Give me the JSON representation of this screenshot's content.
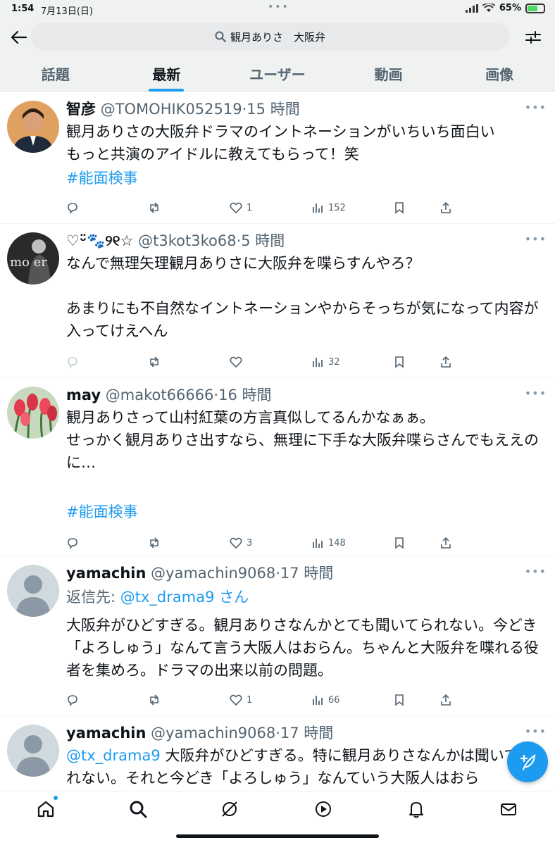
{
  "status_bar": {
    "time": "1:54",
    "date": "7月13日(日)",
    "battery_percent": "65%",
    "battery_level": 0.65
  },
  "search": {
    "query": "観月ありさ　大阪弁"
  },
  "tabs": [
    {
      "label": "話題",
      "active": false
    },
    {
      "label": "最新",
      "active": true
    },
    {
      "label": "ユーザー",
      "active": false
    },
    {
      "label": "動画",
      "active": false
    },
    {
      "label": "画像",
      "active": false
    }
  ],
  "tweets": [
    {
      "name": "智彦",
      "handle": "@TOMOHIK052519",
      "time": "·15 時間",
      "body": "観月ありさの大阪弁ドラマのイントネーションがいちいち面白い\nもっと共演のアイドルに教えてもらって！笑",
      "hashtag": "#能面検事",
      "stats": {
        "replies": "",
        "retweets": "",
        "likes": "1",
        "views": "152"
      }
    },
    {
      "name": "♡ᵕ̈🐾୨୧☆",
      "handle": "@t3kot3ko68",
      "time": "·5 時間",
      "body": "なんで無理矢理観月ありさに大阪弁を喋らすんやろ？\n\nあまりにも不自然なイントネーションやからそっちが気になって内容が入ってけえへん",
      "stats": {
        "replies": "",
        "retweets": "",
        "likes": "",
        "views": "32"
      }
    },
    {
      "name": "may",
      "handle": "@makot66666",
      "time": "·16 時間",
      "body": "観月ありさって山村紅葉の方言真似してるんかなぁぁ。\nせっかく観月ありさ出すなら、無理に下手な大阪弁喋らさんでもええのに…",
      "hashtag": "#能面検事",
      "stats": {
        "replies": "",
        "retweets": "",
        "likes": "3",
        "views": "148"
      }
    },
    {
      "name": "yamachin",
      "handle": "@yamachin9068",
      "time": "·17 時間",
      "reply_prefix": "返信先:",
      "reply_mention": "@tx_drama9",
      "reply_suffix": " さん",
      "body": "大阪弁がひどすぎる。観月ありさなんかとても聞いてられない。今どき「よろしゅう」なんて言う大阪人はおらん。ちゃんと大阪弁を喋れる役者を集めろ。ドラマの出来以前の問題。",
      "stats": {
        "replies": "",
        "retweets": "",
        "likes": "1",
        "views": "66"
      }
    },
    {
      "name": "yamachin",
      "handle": "@yamachin9068",
      "time": "·17 時間",
      "mention": "@tx_drama9",
      "body": " 大阪弁がひどすぎる。特に観月ありさなんかは聞いてられない。それと今どき「よろしゅう」なんていう大阪人はおら"
    }
  ],
  "icons": {
    "back": "arrow-left-icon",
    "search": "search-icon",
    "filter": "sliders-icon",
    "reply": "reply-icon",
    "retweet": "retweet-icon",
    "like": "heart-icon",
    "views": "bar-chart-icon",
    "bookmark": "bookmark-icon",
    "share": "share-icon",
    "compose": "feather-plus-icon",
    "home": "home-icon",
    "explore": "search-icon",
    "grok": "grok-icon",
    "video": "play-icon",
    "notifications": "bell-icon",
    "messages": "envelope-icon"
  },
  "colors": {
    "accent": "#1d9bf0",
    "text": "#0f1419",
    "secondary": "#536471",
    "battery": "#4cd964"
  }
}
